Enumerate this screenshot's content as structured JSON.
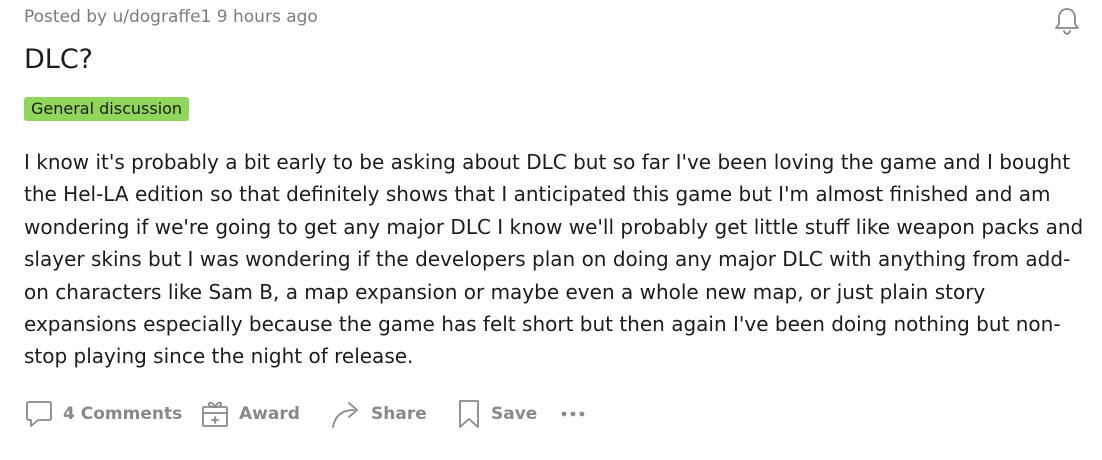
{
  "post": {
    "meta": {
      "prefix": "Posted by",
      "user": "u/dograffe1",
      "time": "9 hours ago"
    },
    "title": "DLC?",
    "flair": "General discussion",
    "body": "I know it's probably a bit early to be asking about DLC but so far I've been loving the game and I bought the Hel-LA edition so that definitely shows that I anticipated this game but I'm almost finished and am wondering if we're going to get any major DLC I know we'll probably get little stuff like weapon packs and slayer skins but I was wondering if the developers plan on doing any major DLC with anything from add-on characters like Sam B, a map expansion or maybe even a whole new map, or just plain story expansions especially because the game has felt short but then again I've been doing nothing but non-stop playing since the night of release.",
    "actions": {
      "comments": "4 Comments",
      "award": "Award",
      "share": "Share",
      "save": "Save"
    },
    "icons": {
      "bell": "bell-icon",
      "comments": "comment-icon",
      "award": "gift-icon",
      "share": "share-arrow-icon",
      "save": "bookmark-icon",
      "more": "more-dots-icon"
    },
    "colors": {
      "flair_bg": "#8fd65b",
      "meta_text": "#7c7c7c",
      "action_text": "#878a8c",
      "text": "#1c1c1c"
    }
  }
}
